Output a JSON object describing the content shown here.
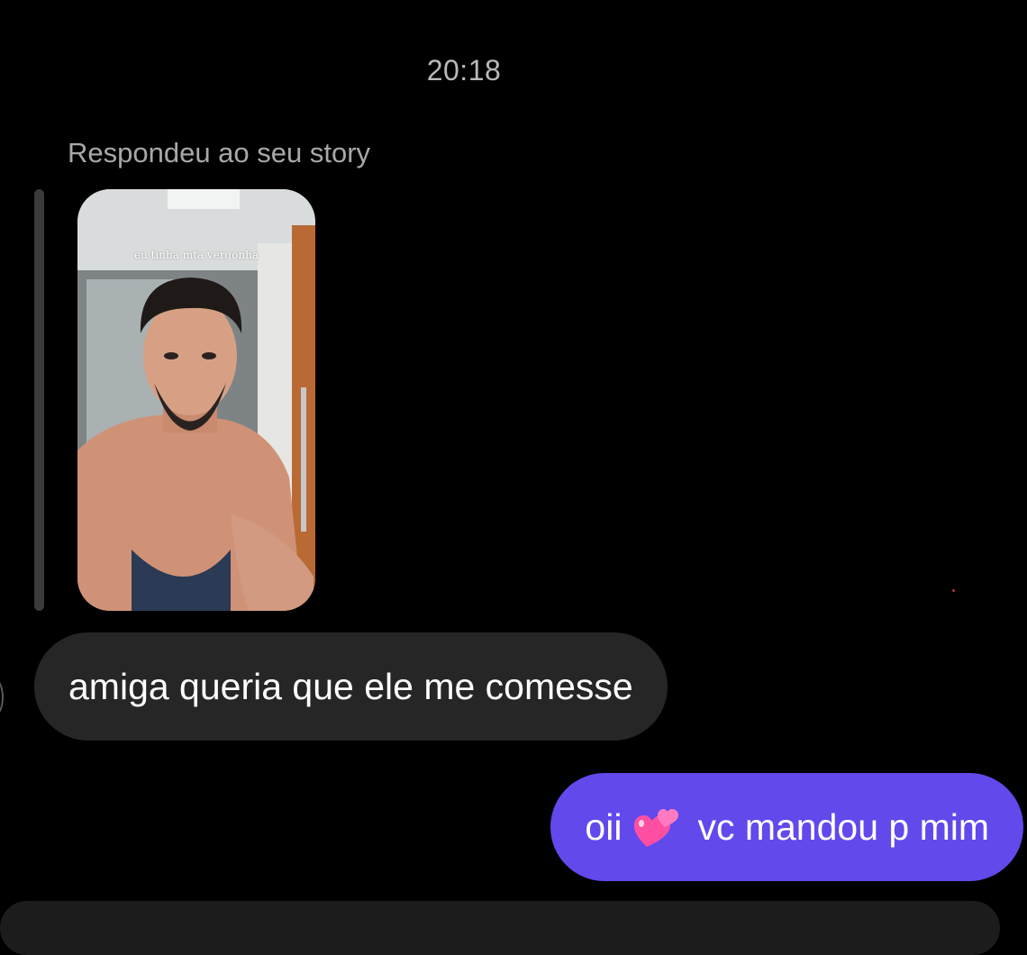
{
  "chat": {
    "timestamp": "20:18",
    "reply_label": "Respondeu ao seu story",
    "story": {
      "caption": "eu tinha mta vergonha"
    },
    "messages": [
      {
        "direction": "incoming",
        "text": "amiga queria que ele me comesse"
      },
      {
        "direction": "outgoing",
        "text_before": "oii",
        "icon": "two-hearts-icon",
        "text_after": "vc mandou p mim"
      }
    ]
  },
  "colors": {
    "background": "#000000",
    "incoming_bubble": "#262626",
    "outgoing_bubble": "#6149ec",
    "timestamp": "#b9b9b9"
  }
}
